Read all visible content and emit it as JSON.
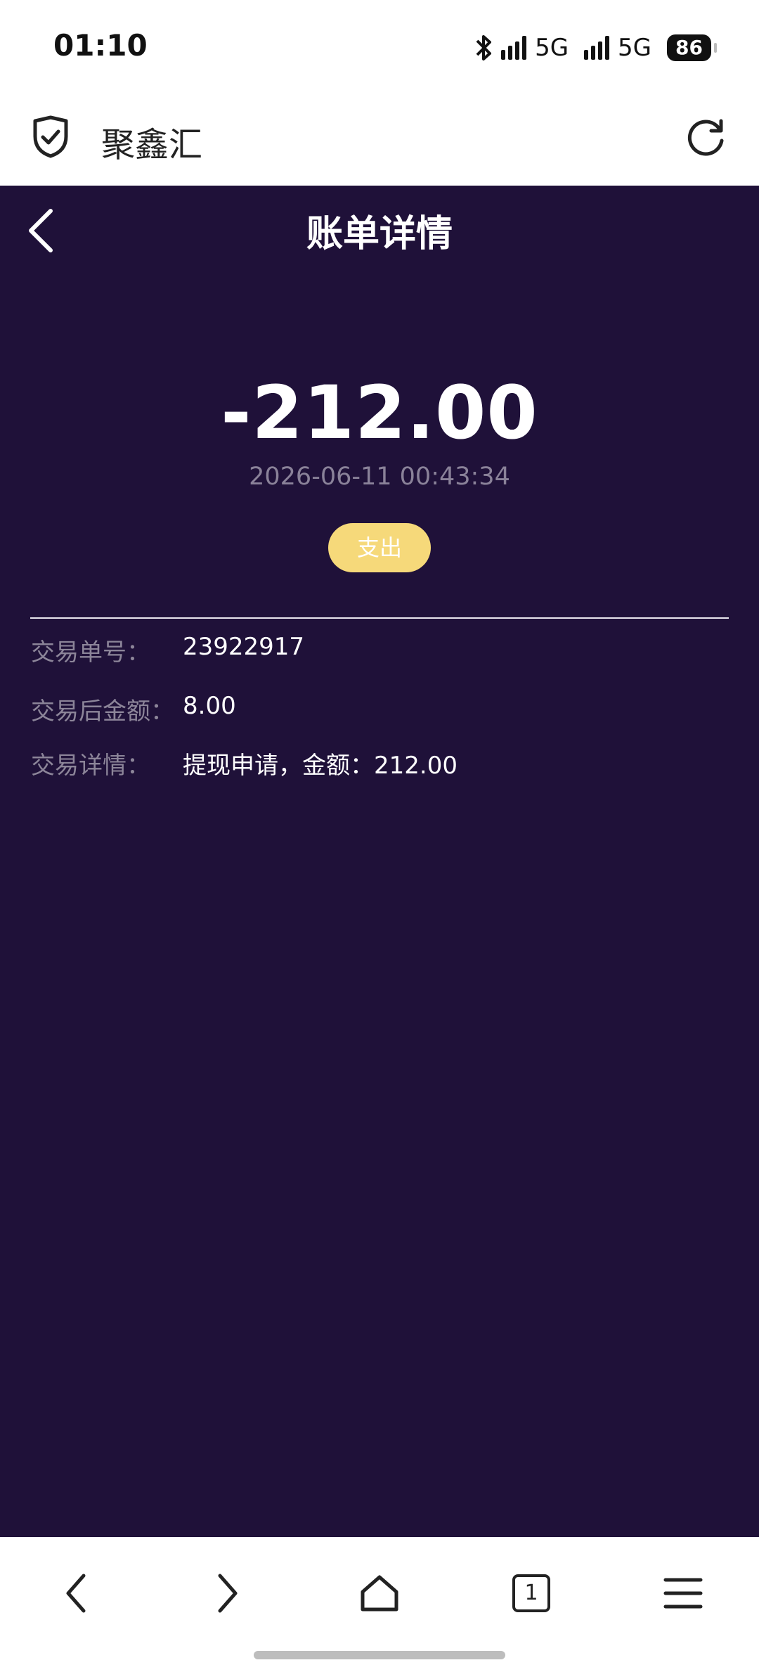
{
  "status_bar": {
    "time": "01:10",
    "network_1": "5G",
    "network_2": "5G",
    "battery": "86",
    "icons": [
      "bluetooth-icon",
      "signal-icon",
      "signal-icon"
    ]
  },
  "browser": {
    "title": "聚鑫汇",
    "icons": [
      "shield-check-icon",
      "reload-icon"
    ]
  },
  "page": {
    "title": "账单详情",
    "amount": "-212.00",
    "datetime": "2026-06-11 00:43:34",
    "type_badge": "支出",
    "details": [
      {
        "label": "交易单号：",
        "value": "23922917"
      },
      {
        "label": "交易后金额：",
        "value": "8.00"
      },
      {
        "label": "交易详情：",
        "value": "提现申请，金额：212.00"
      }
    ]
  },
  "bottom_nav": {
    "tab_count": "1",
    "icons": [
      "back-icon",
      "forward-icon",
      "home-icon",
      "tabs-icon",
      "menu-icon"
    ]
  },
  "colors": {
    "background": "#1f1139",
    "badge": "#f6d97a",
    "muted_text": "#8a8299"
  }
}
